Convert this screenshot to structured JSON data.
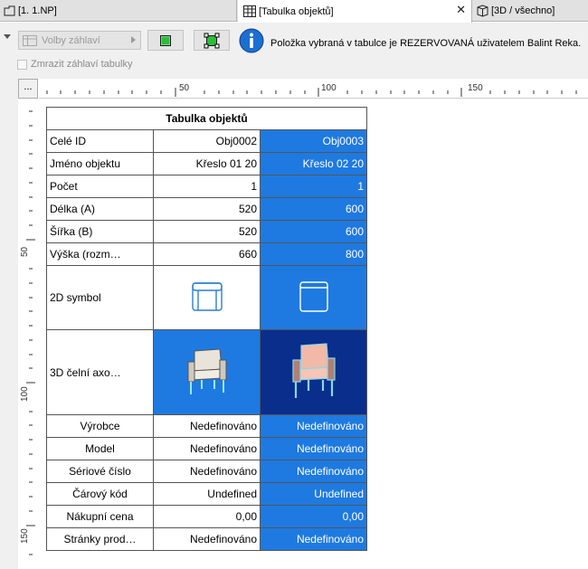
{
  "tabs": [
    {
      "label": "[1. 1.NP]",
      "icon": "floor-plan-icon"
    },
    {
      "label": "[Tabulka objektů]",
      "icon": "table-icon",
      "close": "✕"
    },
    {
      "label": "[3D / všechno]",
      "icon": "3d-box-icon"
    }
  ],
  "toolbar": {
    "header_options_label": "Volby záhlaví",
    "freeze_header_label": "Zmrazit záhlaví tabulky",
    "freeze_header_checked": false,
    "info_message": "Položka vybraná v tabulce je REZERVOVANÁ uživatelem Balint Reka.",
    "button_colors": {
      "accent": "#2bbd3a",
      "info": "#1b6fd1"
    }
  },
  "ruler": {
    "corner_label": "...",
    "horizontal_labels": [
      "50",
      "100",
      "150"
    ],
    "vertical_labels": [
      "50",
      "100",
      "150"
    ]
  },
  "table": {
    "title": "Tabulka objektů",
    "rows": [
      {
        "label": "Celé ID",
        "v1": "Obj0002",
        "v2": "Obj0003",
        "centered": false
      },
      {
        "label": "Jméno objektu",
        "v1": "Křeslo 01 20",
        "v2": "Křeslo 02 20",
        "centered": false
      },
      {
        "label": "Počet",
        "v1": "1",
        "v2": "1",
        "centered": false
      },
      {
        "label": "Délka (A)",
        "v1": "520",
        "v2": "600",
        "centered": false
      },
      {
        "label": "Šířka (B)",
        "v1": "520",
        "v2": "600",
        "centered": false
      },
      {
        "label": "Výška (rozm…",
        "v1": "660",
        "v2": "800",
        "centered": false
      }
    ],
    "symbol_label": "2D symbol",
    "axo_label": "3D čelní axo…",
    "rows_bottom": [
      {
        "label": "Výrobce",
        "v1": "Nedefinováno",
        "v2": "Nedefinováno"
      },
      {
        "label": "Model",
        "v1": "Nedefinováno",
        "v2": "Nedefinováno"
      },
      {
        "label": "Sériové číslo",
        "v1": "Nedefinováno",
        "v2": "Nedefinováno"
      },
      {
        "label": "Čárový kód",
        "v1": "Undefined",
        "v2": "Undefined"
      },
      {
        "label": "Nákupní cena",
        "v1": "0,00",
        "v2": "0,00"
      },
      {
        "label": "Stránky prod…",
        "v1": "Nedefinováno",
        "v2": "Nedefinováno"
      }
    ],
    "colors": {
      "selected": "#1e7ae0",
      "selected_dark": "#0a2e8c"
    }
  }
}
